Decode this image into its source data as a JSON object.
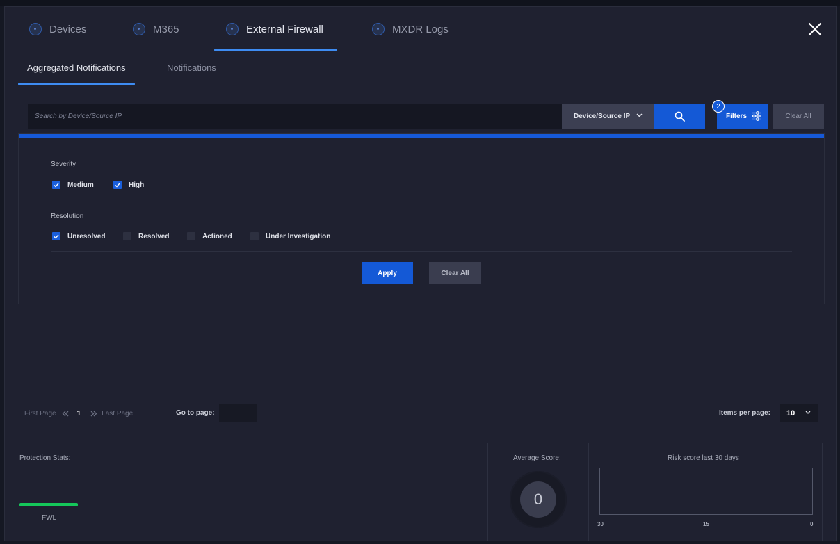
{
  "tabs": [
    {
      "label": "Devices",
      "active": false
    },
    {
      "label": "M365",
      "active": false
    },
    {
      "label": "External Firewall",
      "active": true
    },
    {
      "label": "MXDR Logs",
      "active": false
    }
  ],
  "subtabs": [
    {
      "label": "Aggregated Notifications",
      "active": true
    },
    {
      "label": "Notifications",
      "active": false
    }
  ],
  "search": {
    "placeholder": "Search by Device/Source IP",
    "field_label": "Device/Source IP",
    "filters_label": "Filters",
    "filters_count": "2",
    "clear_all_label": "Clear All"
  },
  "filters": {
    "severity_label": "Severity",
    "severity_options": [
      {
        "label": "Medium",
        "checked": true
      },
      {
        "label": "High",
        "checked": true
      }
    ],
    "resolution_label": "Resolution",
    "resolution_options": [
      {
        "label": "Unresolved",
        "checked": true
      },
      {
        "label": "Resolved",
        "checked": false
      },
      {
        "label": "Actioned",
        "checked": false
      },
      {
        "label": "Under Investigation",
        "checked": false
      }
    ],
    "apply_label": "Apply",
    "clear_label": "Clear All"
  },
  "pagination": {
    "first_page": "First Page",
    "current_page": "1",
    "last_page": "Last Page",
    "goto_label": "Go to page:",
    "goto_value": "",
    "items_per_page_label": "Items per page:",
    "items_per_page": "10"
  },
  "stats": {
    "protection_label": "Protection Stats:",
    "protection_item": "FWL",
    "average_label": "Average Score:",
    "average_value": "0",
    "risk_label": "Risk score last 30 days",
    "risk_ticks": [
      "30",
      "15",
      "0"
    ]
  },
  "colors": {
    "accent": "#1459d6",
    "tab_underline": "#3e8cf2",
    "protection_bar": "#15c75a",
    "background": "#1f2130"
  },
  "icons": {
    "close": "close-icon",
    "search": "search-icon",
    "filters": "sliders-icon",
    "chevron": "chevron-down-icon"
  }
}
